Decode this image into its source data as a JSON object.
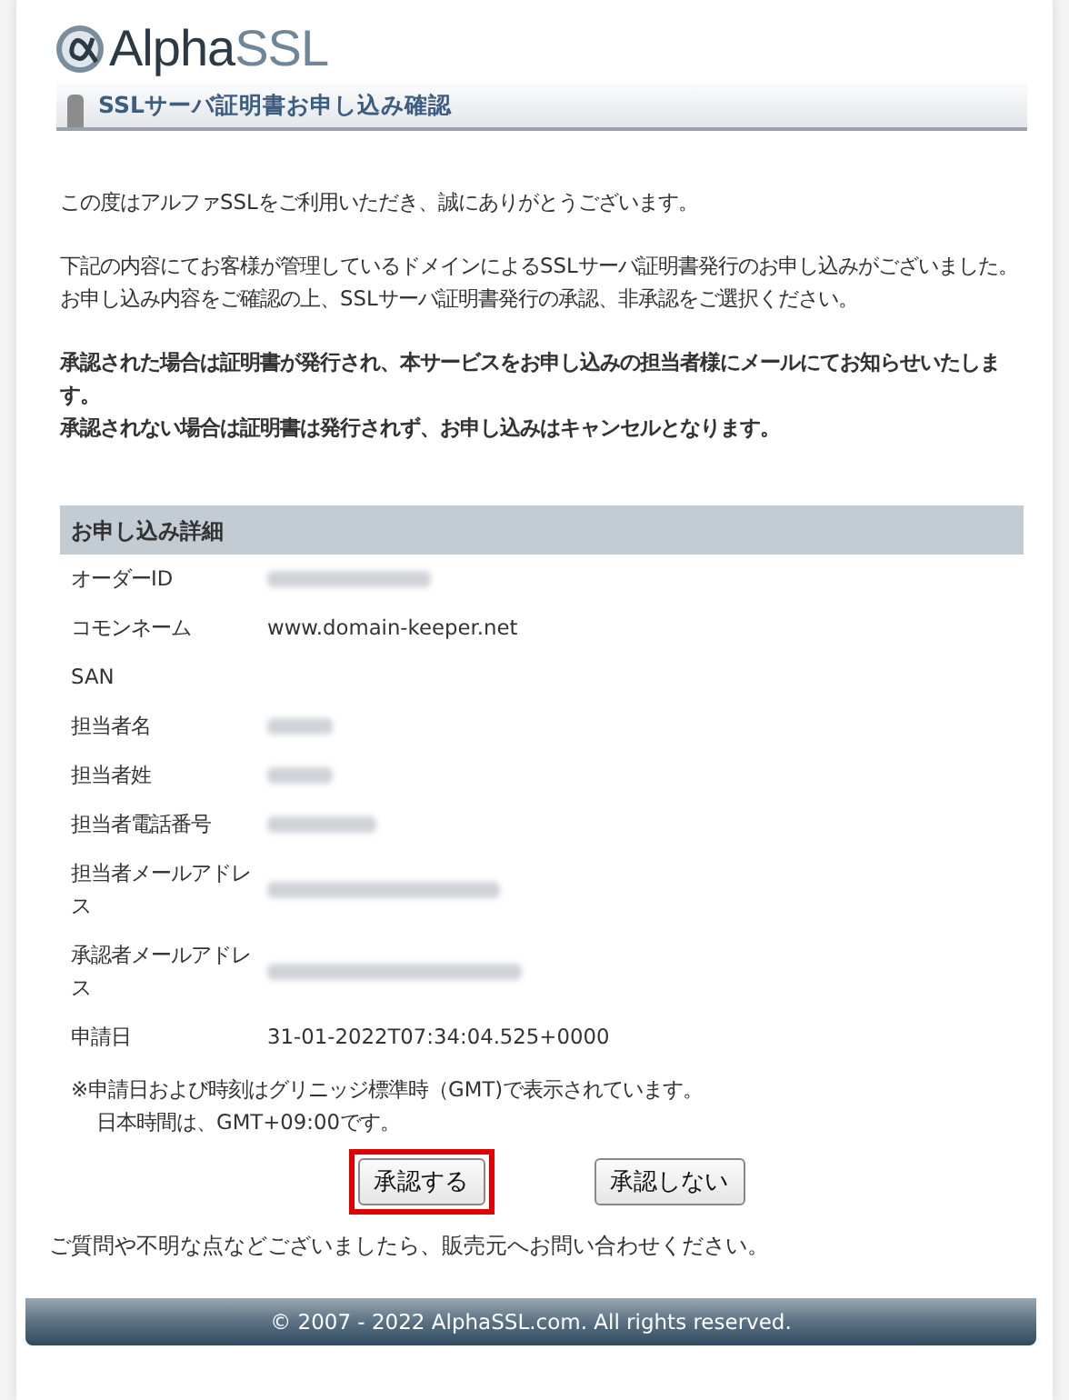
{
  "logo": {
    "prefix": "Alpha",
    "suffix": "SSL"
  },
  "page_title": "SSLサーバ証明書お申し込み確認",
  "intro": [
    "この度はアルファSSLをご利用いただき、誠にありがとうございます。"
  ],
  "instructions": [
    "下記の内容にてお客様が管理しているドメインによるSSLサーバ証明書発行のお申し込みがございました。",
    "お申し込み内容をご確認の上、SSLサーバ証明書発行の承認、非承認をご選択ください。"
  ],
  "notices": [
    "承認された場合は証明書が発行され、本サービスをお申し込みの担当者様にメールにてお知らせいたします。",
    "承認されない場合は証明書は発行されず、お申し込みはキャンセルとなります。"
  ],
  "details": {
    "title": "お申し込み詳細",
    "rows": [
      {
        "label": "オーダーID",
        "redacted": true
      },
      {
        "label": "コモンネーム",
        "value": "www.domain-keeper.net",
        "redacted": false
      },
      {
        "label": "SAN",
        "redacted": false
      },
      {
        "label": "担当者名",
        "redacted": true
      },
      {
        "label": "担当者姓",
        "redacted": true
      },
      {
        "label": "担当者電話番号",
        "redacted": true
      },
      {
        "label": "担当者メールアドレス",
        "redacted": true
      },
      {
        "label": "承認者メールアドレス",
        "redacted": true
      },
      {
        "label": "申請日",
        "value": "31-01-2022T07:34:04.525+0000",
        "redacted": false
      }
    ]
  },
  "time_note": [
    "※申請日および時刻はグリニッジ標準時（GMT)で表示されています。",
    "日本時間は、GMT+09:00です。"
  ],
  "buttons": [
    {
      "label": "承認する",
      "highlighted": true
    },
    {
      "label": "承認しない",
      "highlighted": false
    }
  ],
  "contact": "ご質問や不明な点などございましたら、販売元へお問い合わせください。",
  "footer": "© 2007 - 2022 AlphaSSL.com. All rights reserved."
}
